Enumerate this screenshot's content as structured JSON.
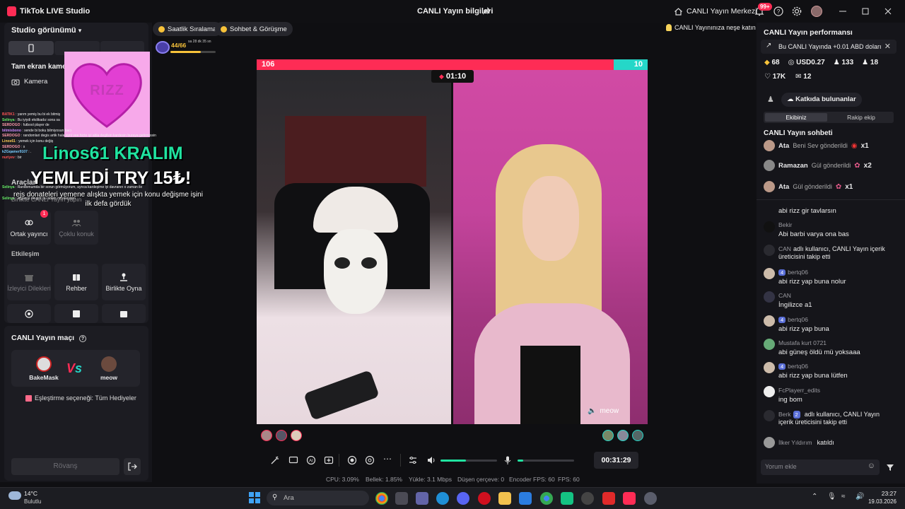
{
  "titlebar": {
    "app_title": "TikTok LIVE Studio",
    "live_info": "CANLI Yayın bilgileri",
    "center_label": "CANLI Yayın Merkezi",
    "notif_badge": "99+"
  },
  "left": {
    "studio_view": "Studio görünümü",
    "fullscreen_camera": "Tam ekran kamera",
    "camera": "Kamera",
    "tools_title": "Araçlar",
    "together_live": "Birlikte CANLI Yayın yapın",
    "cohost": "Ortak yayıncı",
    "cohost_badge": "1",
    "multi_guest": "Çoklu konuk",
    "interaction": "Etkileşim",
    "viewer_wishes": "İzleyici Dilekleri",
    "guide": "Rehber",
    "play_together": "Birlikte Oyna",
    "match_title": "CANLI Yayın maçı",
    "player_a": "BakeMask",
    "player_b": "meow",
    "vs": "VS",
    "match_option": "Eşleştirme seçeneği: Tüm Hediyeler",
    "rematch": "Rövanş"
  },
  "overlay": {
    "sticker_text": "RIZZ",
    "alert_line1": "Linos61 KRALIM",
    "alert_line2": "YEMLEDİ TRY 15₺!",
    "alert_sub": "rejs donateleri yemene alışkta yemek için konu değişme işini ilk defa gördük",
    "chat_lines": [
      {
        "name": "BATIK1",
        "msg": "yarım yemiş bu bi ek bitmiş"
      },
      {
        "name": "Selinya",
        "msg": "Bu iyiydi ekdikadız sona sa"
      },
      {
        "name": "SERDOGO",
        "msg": "futbool player de"
      },
      {
        "name": "bitmisbono",
        "msg": "sende bi boku bilmiyosun bacı"
      },
      {
        "name": "SERDOGO",
        "msg": "randomlari degis artik hala ayni vee hicte iyi abla degilsin kardesin buraya getirmissin"
      },
      {
        "name": "Linos61",
        "msg": "yemek için konu değiş"
      },
      {
        "name": "SERDOGO",
        "msg": "s"
      },
      {
        "name": "kZGqamer9107",
        "msg": "."
      },
      {
        "name": "nuriyev",
        "msg": "bir"
      },
      {
        "name": "Selinya",
        "msg": "Randomumda bir sorun görmüyorum, ayrıca kardeşime iyi davranın o zaman ile"
      },
      {
        "name": "Selinya",
        "msg": "ingilizce okuyor bu adam monkeyden"
      }
    ]
  },
  "topbar": {
    "hourly_rank": "Saatlik Sıralama",
    "chat_meet": "Sohbet & Görüşme",
    "level_progress": "44/66",
    "level_progress_fraction": 0.67,
    "level_timer": "sa 28 dk 35 sn",
    "promo": "CANLI Yayınınıza neşe katın"
  },
  "battle": {
    "score_left": "106",
    "score_right": "10",
    "left_share": 0.914,
    "timer": "01:10",
    "right_name": "meow"
  },
  "controls": {
    "duration": "00:31:29",
    "volume_level": 0.45,
    "mic_level": 0.1
  },
  "stats": {
    "cpu": "CPU: 3.09%",
    "memory": "Bellek: 1.85%",
    "upload": "Yükle: 3.1 Mbps",
    "dropped": "Düşen çerçeve: 0",
    "encoder_fps": "Encoder FPS: 60",
    "fps": "FPS: 60"
  },
  "right": {
    "perf_title": "CANLI Yayın performansı",
    "banner": "Bu CANLI Yayında +0.01 ABD doları",
    "diamonds": "68",
    "usd": "USD0.27",
    "viewers": "133",
    "followers": "18",
    "likes": "17K",
    "shares": "12",
    "contributors": "Katkıda bulunanlar",
    "tab_our": "Ekibiniz",
    "tab_rival": "Rakip ekip",
    "chat_title": "CANLI Yayın sohbeti",
    "gifts": [
      {
        "name": "Ata",
        "text": "Beni Sev gönderildi",
        "count": "x1"
      },
      {
        "name": "Ramazan",
        "text": "Gül gönderildi",
        "count": "x2"
      },
      {
        "name": "Ata",
        "text": "Gül gönderildi",
        "count": "x1"
      }
    ],
    "messages": [
      {
        "name": "",
        "level": "",
        "msg": "abi rizz gir tavlarsın"
      },
      {
        "name": "Bekir",
        "level": "",
        "msg": "Abi barbi varya ona bas"
      },
      {
        "name": "CAN",
        "level": "",
        "msg": "adlı kullanıcı, CANLI Yayın içerik üreticisini takip etti",
        "inline": true
      },
      {
        "name": "bertq06",
        "level": "4",
        "msg": "abi rizz yap buna nolur"
      },
      {
        "name": "CAN",
        "level": "",
        "msg": "İngilizce a1"
      },
      {
        "name": "bertq06",
        "level": "4",
        "msg": "abi rizz yap buna"
      },
      {
        "name": "Mustafa kurt 0721",
        "level": "",
        "msg": "abi güneş öldü mü yoksaaa"
      },
      {
        "name": "bertq06",
        "level": "4",
        "msg": "abi rizz yap buna lütfen"
      },
      {
        "name": "FcPlayerr_edits",
        "level": "",
        "msg": "ing bom"
      },
      {
        "name": "Berk",
        "level": "2",
        "msg": "adlı kullanıcı, CANLI Yayın içerik üreticisini takip etti",
        "inline": true
      },
      {
        "name": "İlker Yıldırım",
        "level": "",
        "msg": "katıldı",
        "inline": true
      }
    ],
    "comment_placeholder": "Yorum ekle"
  },
  "taskbar": {
    "temp": "14°C",
    "weather": "Bulutlu",
    "search": "Ara",
    "time": "23:27",
    "date": "19.03.2026"
  },
  "colors": {
    "accent_pink": "#fe2c55",
    "accent_teal": "#25d7c8",
    "accent_green": "#20e3a0"
  }
}
